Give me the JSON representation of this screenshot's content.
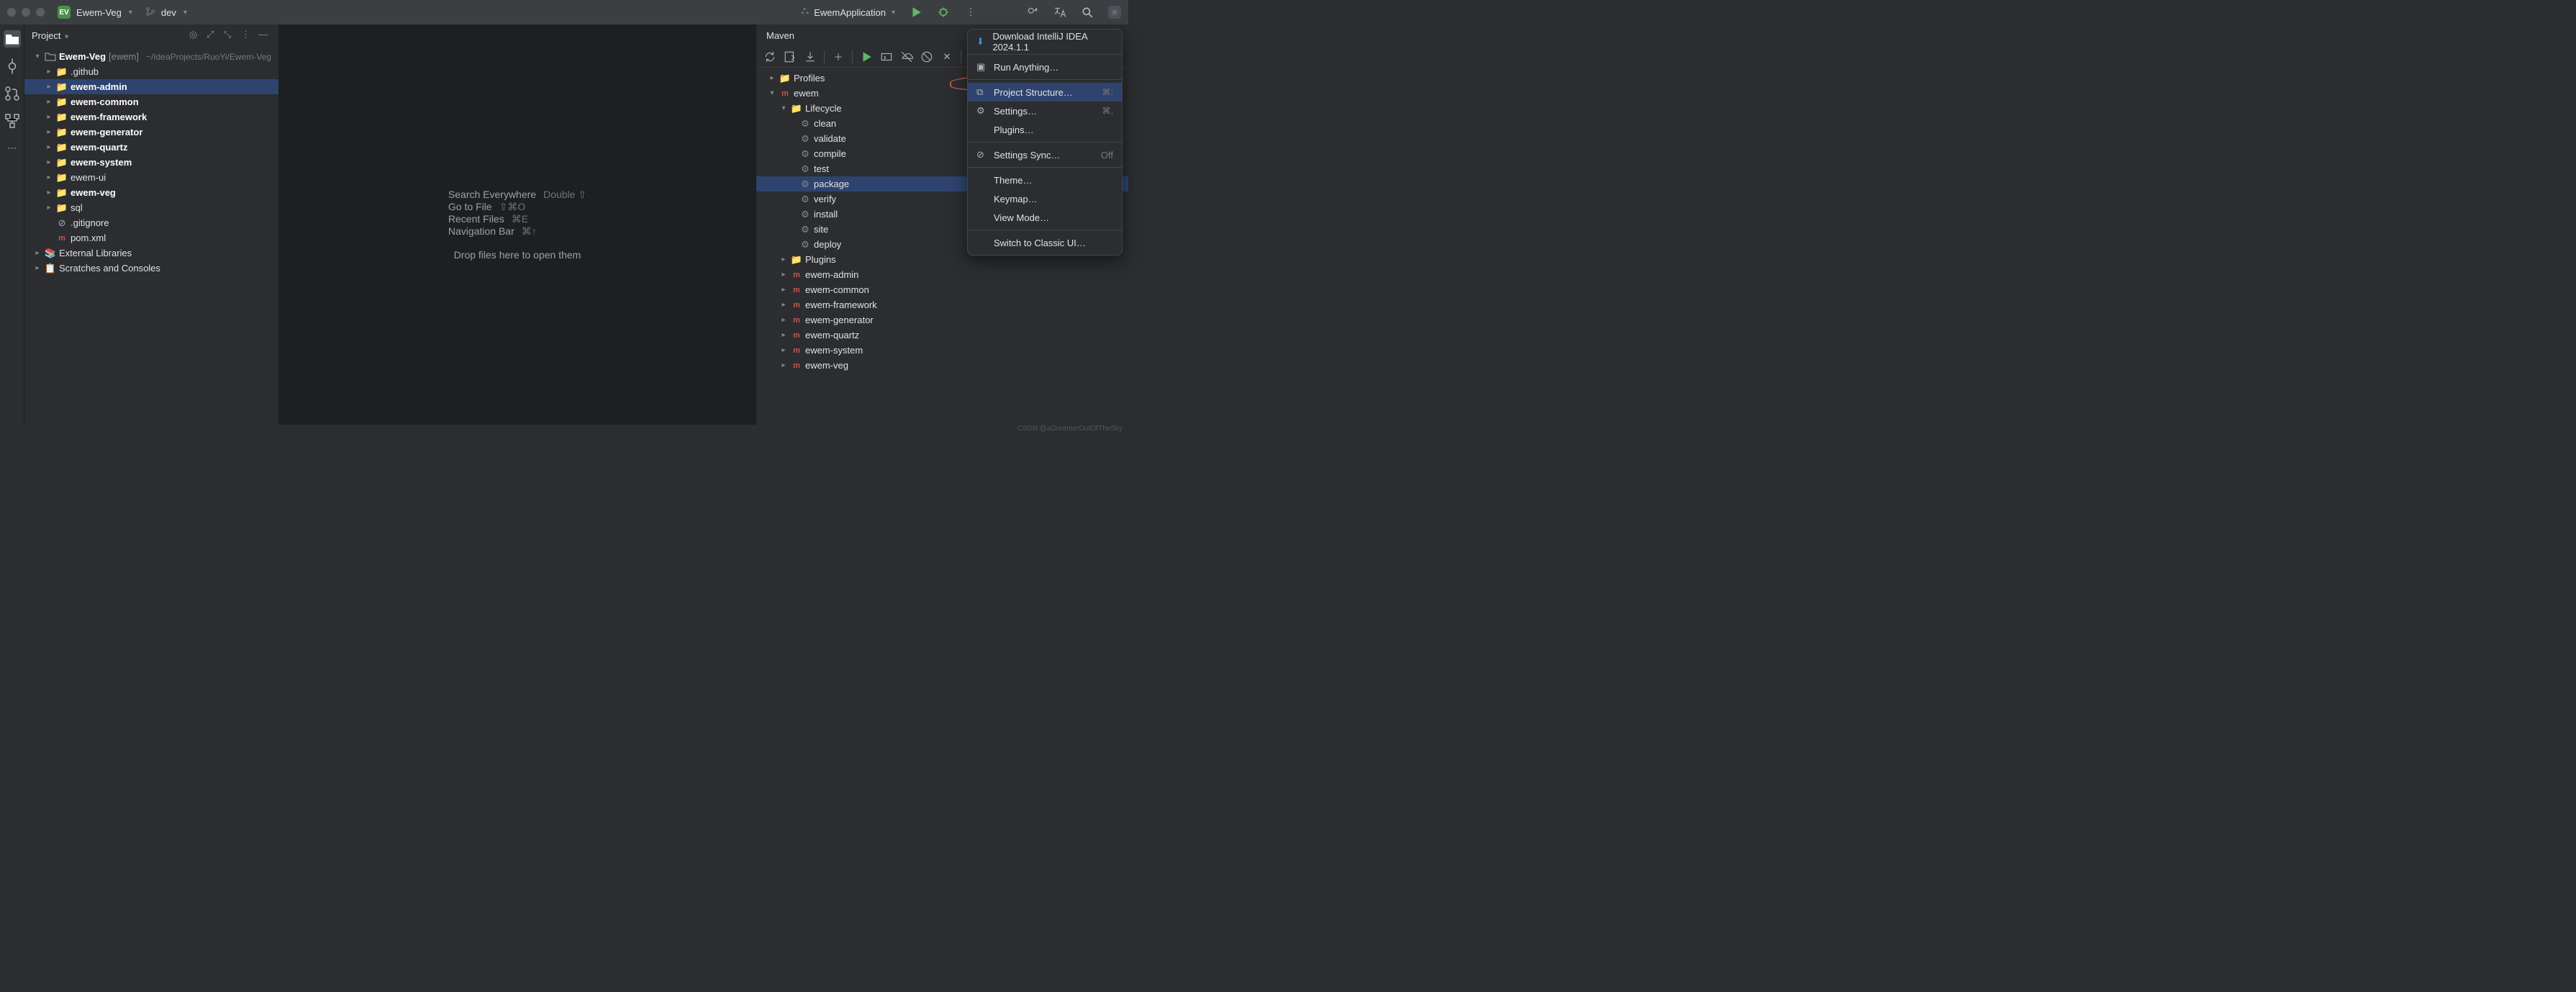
{
  "titlebar": {
    "badge": "EV",
    "project_name": "Ewem-Veg",
    "branch": "dev",
    "run_config": "EwemApplication"
  },
  "project_panel": {
    "title": "Project",
    "root_name": "Ewem-Veg",
    "root_bracket": "[ewem]",
    "root_path": "~/IdeaProjects/RuoYi/Ewem-Veg",
    "items": [
      {
        "name": ".github",
        "type": "folder"
      },
      {
        "name": "ewem-admin",
        "type": "folder",
        "bold": true,
        "selected": true
      },
      {
        "name": "ewem-common",
        "type": "folder",
        "bold": true
      },
      {
        "name": "ewem-framework",
        "type": "folder",
        "bold": true
      },
      {
        "name": "ewem-generator",
        "type": "folder",
        "bold": true
      },
      {
        "name": "ewem-quartz",
        "type": "folder",
        "bold": true
      },
      {
        "name": "ewem-system",
        "type": "folder",
        "bold": true
      },
      {
        "name": "ewem-ui",
        "type": "folder"
      },
      {
        "name": "ewem-veg",
        "type": "folder",
        "bold": true
      },
      {
        "name": "sql",
        "type": "folder"
      },
      {
        "name": ".gitignore",
        "type": "file-ignore"
      },
      {
        "name": "pom.xml",
        "type": "maven"
      }
    ],
    "external": "External Libraries",
    "scratches": "Scratches and Consoles"
  },
  "editor": {
    "rows": [
      {
        "label": "Search Everywhere",
        "shortcut": "Double ⇧"
      },
      {
        "label": "Go to File",
        "shortcut": "⇧⌘O"
      },
      {
        "label": "Recent Files",
        "shortcut": "⌘E"
      },
      {
        "label": "Navigation Bar",
        "shortcut": "⌘↑"
      }
    ],
    "drop": "Drop files here to open them"
  },
  "maven": {
    "title": "Maven",
    "profiles": "Profiles",
    "root": "ewem",
    "lifecycle": "Lifecycle",
    "phases": [
      "clean",
      "validate",
      "compile",
      "test",
      "package",
      "verify",
      "install",
      "site",
      "deploy"
    ],
    "selected_phase": "package",
    "plugins": "Plugins",
    "modules": [
      "ewem-admin",
      "ewem-common",
      "ewem-framework",
      "ewem-generator",
      "ewem-quartz",
      "ewem-system",
      "ewem-veg"
    ]
  },
  "popup": {
    "download": "Download IntelliJ IDEA 2024.1.1",
    "run_anything": "Run Anything…",
    "project_structure": "Project Structure…",
    "ps_sc": "⌘;",
    "settings": "Settings…",
    "settings_sc": "⌘,",
    "plugins": "Plugins…",
    "sync": "Settings Sync…",
    "sync_state": "Off",
    "theme": "Theme…",
    "keymap": "Keymap…",
    "viewmode": "View Mode…",
    "classic": "Switch to Classic UI…"
  },
  "watermark": "CSDN @aDreamerOutOfTheSky"
}
